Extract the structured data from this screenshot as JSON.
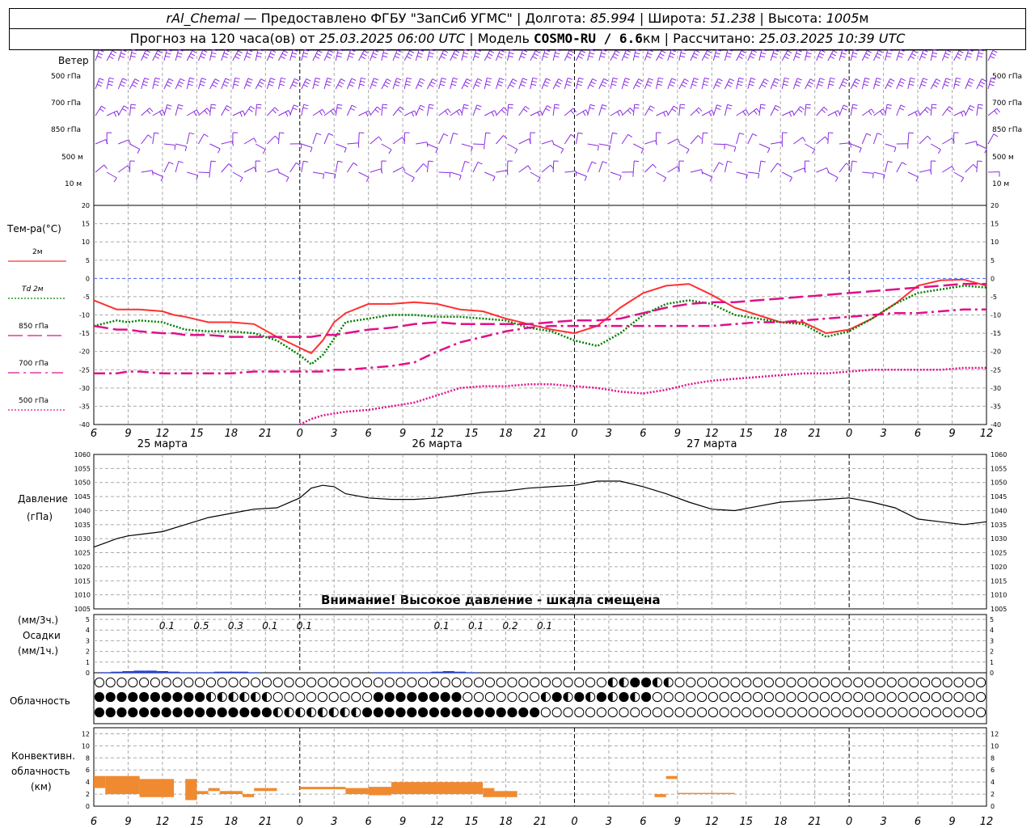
{
  "header": {
    "station": "rAl_Chemal",
    "provided": " — Предоставлено ФГБУ \"ЗапСиб УГМС\" | Долгота: ",
    "lon": "85.994",
    "lat_label": " | Широта: ",
    "lat": "51.238",
    "alt_label": " | Высота: ",
    "alt": "1005",
    "alt_unit": "м",
    "forecast_prefix": "Прогноз на 120 часа(ов) от ",
    "forecast_time": "25.03.2025 06:00 UTC",
    "model_label": " | Модель ",
    "model": "COSMO-RU / 6.6",
    "model_unit": "км",
    "calc_label": " | Рассчитано: ",
    "calc_time": "25.03.2025 10:39 UTC"
  },
  "wind_panel": {
    "title": "Ветер",
    "levels": [
      "500 гПа",
      "700 гПа",
      "850 гПа",
      "500 м",
      "10 м"
    ],
    "color": "#8a2be2"
  },
  "temp_panel": {
    "title": "Тем-ра(°C)",
    "legend": [
      {
        "label": "2м",
        "color": "#ff3030",
        "style": "solid"
      },
      {
        "label": "Td 2м",
        "color": "#008000",
        "style": "dotted"
      },
      {
        "label": "850 гПа",
        "color": "#e0108a",
        "style": "dash"
      },
      {
        "label": "700 гПа",
        "color": "#e0108a",
        "style": "dashdot"
      },
      {
        "label": "500 гПа",
        "color": "#e0108a",
        "style": "dot"
      }
    ]
  },
  "pressure_panel": {
    "title": "Давление",
    "unit": "(гПа)",
    "warning": "Внимание! Высокое давление - шкала смещена"
  },
  "precip_panel": {
    "unit1": "(мм/3ч.)",
    "title": "Осадки",
    "unit2": "(мм/1ч.)",
    "labels": [
      {
        "h": 6,
        "text": "0.1"
      },
      {
        "h": 9,
        "text": "0.5"
      },
      {
        "h": 12,
        "text": "0.3"
      },
      {
        "h": 15,
        "text": "0.1"
      },
      {
        "h": 18,
        "text": "0.1"
      },
      {
        "h": 30,
        "text": "0.1"
      },
      {
        "h": 33,
        "text": "0.1"
      },
      {
        "h": 36,
        "text": "0.2"
      },
      {
        "h": 39,
        "text": "0.1"
      }
    ]
  },
  "cloud_panel": {
    "title": "Облачность"
  },
  "conv_panel": {
    "title1": "Конвективн.",
    "title2": "облачность",
    "unit": "(км)"
  },
  "x_axis": {
    "hour_labels": [
      "6",
      "9",
      "12",
      "15",
      "18",
      "21",
      "0",
      "3",
      "6",
      "9",
      "12",
      "15",
      "18",
      "21",
      "0",
      "3",
      "6",
      "9",
      "12",
      "15",
      "18",
      "21",
      "0",
      "3",
      "6",
      "9",
      "12"
    ],
    "day_labels": [
      {
        "text": "25 марта",
        "at_hour": 12
      },
      {
        "text": "26 марта",
        "at_hour": 36
      },
      {
        "text": "27 марта",
        "at_hour": 60
      }
    ]
  },
  "chart_data": [
    {
      "type": "line",
      "title": "Тем-ра(°C)",
      "ylim": [
        -40,
        20
      ],
      "x_hours_from_start": [
        0,
        2,
        3,
        4,
        6,
        7,
        8,
        10,
        12,
        14,
        16,
        18,
        19,
        20,
        21,
        22,
        24,
        26,
        28,
        30,
        32,
        34,
        36,
        38,
        40,
        42,
        44,
        46,
        48,
        50,
        52,
        54,
        56,
        58,
        60,
        62,
        64,
        66,
        68,
        70,
        72,
        74,
        76,
        78
      ],
      "series": [
        {
          "name": "2м",
          "values": [
            -6,
            -8.5,
            -8.5,
            -8.5,
            -9,
            -10,
            -10.5,
            -12,
            -12,
            -12.5,
            -16,
            -19,
            -20.5,
            -17,
            -12,
            -9.5,
            -7,
            -7,
            -6.5,
            -7,
            -8.5,
            -9,
            -11,
            -12.5,
            -14,
            -15,
            -13,
            -8,
            -4,
            -2,
            -1.5,
            -4.5,
            -8,
            -10,
            -12,
            -12,
            -15,
            -14,
            -11,
            -7,
            -2,
            -0.5,
            -0.3,
            -2
          ]
        },
        {
          "name": "Td 2м",
          "values": [
            -13,
            -11.5,
            -12,
            -11.5,
            -12,
            -13,
            -14,
            -14.5,
            -14.5,
            -15,
            -17,
            -21,
            -23.5,
            -21,
            -16.5,
            -12,
            -11,
            -10,
            -10,
            -10.5,
            -10.5,
            -11,
            -11.5,
            -13.5,
            -14.5,
            -17,
            -18.5,
            -15,
            -10,
            -7,
            -6,
            -7,
            -10,
            -11,
            -12,
            -12.5,
            -16,
            -14.5,
            -11,
            -7,
            -4,
            -3,
            -2,
            -2.5
          ]
        },
        {
          "name": "850 гПа",
          "values": [
            -13,
            -14,
            -14,
            -14.5,
            -15,
            -15,
            -15.5,
            -15.5,
            -16,
            -16,
            -16,
            -16,
            -16,
            -15.5,
            -15.5,
            -15,
            -14,
            -13.5,
            -12.5,
            -12,
            -12.5,
            -12.5,
            -12.5,
            -12.5,
            -12,
            -11.5,
            -11.5,
            -11,
            -9.5,
            -8,
            -7,
            -6.5,
            -6.5,
            -6,
            -5.5,
            -5,
            -4.5,
            -4,
            -3.5,
            -3,
            -2.5,
            -2,
            -1.5,
            -1.5
          ]
        },
        {
          "name": "700 гПа",
          "values": [
            -26,
            -26,
            -25.5,
            -25.5,
            -26,
            -26,
            -26,
            -26,
            -26,
            -25.5,
            -25.5,
            -25.5,
            -25.5,
            -25.5,
            -25,
            -25,
            -24.5,
            -24,
            -23,
            -20,
            -17.5,
            -16,
            -14.5,
            -13.5,
            -13,
            -13,
            -13,
            -13,
            -13,
            -13,
            -13,
            -13,
            -12.5,
            -12,
            -12,
            -11.5,
            -11,
            -10.5,
            -10,
            -9.5,
            -9.5,
            -9,
            -8.5,
            -8.5
          ]
        },
        {
          "name": "500 гПа",
          "values": [
            null,
            null,
            null,
            null,
            null,
            null,
            null,
            null,
            null,
            null,
            null,
            -40,
            -38.5,
            -37.5,
            -37,
            -36.5,
            -36,
            -35,
            -34,
            -32,
            -30,
            -29.5,
            -29.5,
            -29,
            -29,
            -29.5,
            -30,
            -31,
            -31.5,
            -30.5,
            -29,
            -28,
            -27.5,
            -27,
            -26.5,
            -26,
            -26,
            -25.5,
            -25,
            -25,
            -25,
            -25,
            -24.5,
            -24.5
          ]
        }
      ]
    },
    {
      "type": "line",
      "title": "Давление",
      "ylim": [
        1005,
        1060
      ],
      "x_hours_from_start": [
        0,
        1,
        2,
        3,
        4,
        6,
        8,
        10,
        12,
        14,
        16,
        18,
        19,
        20,
        21,
        22,
        24,
        26,
        28,
        30,
        32,
        34,
        36,
        38,
        40,
        42,
        44,
        46,
        48,
        50,
        52,
        54,
        56,
        58,
        60,
        62,
        64,
        66,
        68,
        70,
        72,
        74,
        76,
        78
      ],
      "series": [
        {
          "name": "Давление",
          "values": [
            1027,
            1028.5,
            1030,
            1031,
            1031.5,
            1032.5,
            1035,
            1037.5,
            1039,
            1040.5,
            1041,
            1044.5,
            1048,
            1049,
            1048.5,
            1046,
            1044.5,
            1044,
            1044,
            1044.5,
            1045.5,
            1046.5,
            1047,
            1048,
            1048.5,
            1049,
            1050.5,
            1050.5,
            1048.5,
            1046,
            1043,
            1040.5,
            1040,
            1041.5,
            1043,
            1043.5,
            1044,
            1044.5,
            1043,
            1041,
            1037,
            1036,
            1035,
            1036
          ]
        }
      ]
    },
    {
      "type": "bar",
      "title": "Осадки",
      "ylabel": "мм/1ч.",
      "ylim": [
        0,
        5
      ],
      "x_hours_from_start": [
        1,
        2,
        3,
        4,
        5,
        6,
        7,
        8,
        9,
        10,
        11,
        12,
        13,
        14,
        25,
        26,
        27,
        28,
        29,
        30,
        31,
        32,
        33
      ],
      "values": [
        0.05,
        0.1,
        0.15,
        0.2,
        0.2,
        0.15,
        0.1,
        0.05,
        0.05,
        0.05,
        0.1,
        0.1,
        0.1,
        0.05,
        0.05,
        0.05,
        0.05,
        0.05,
        0.05,
        0.1,
        0.15,
        0.1,
        0.05
      ]
    }
  ]
}
